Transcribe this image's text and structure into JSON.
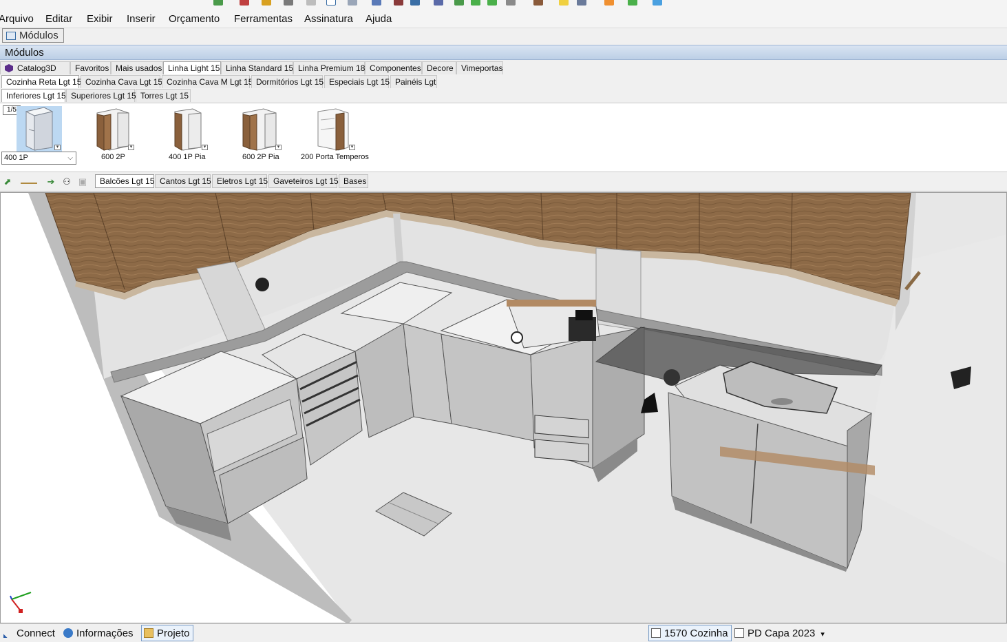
{
  "colors": {
    "accent": "#3a6ea5",
    "panel_header": "#c7d7ec",
    "wood": "#8b6845",
    "cabinet_gray": "#c9c9c9",
    "selected_module": "#bcd8f2"
  },
  "menu": {
    "items": [
      "Arquivo",
      "Editar",
      "Exibir",
      "Inserir",
      "Orçamento",
      "Ferramentas",
      "Assinatura",
      "Ajuda"
    ]
  },
  "doc_tab": {
    "label": "Módulos",
    "icon": "window-icon"
  },
  "panel": {
    "title": "Módulos"
  },
  "library_tabs": [
    {
      "label": "Catalog3D",
      "icon": "catalog-cube-icon"
    },
    {
      "label": "Favoritos"
    },
    {
      "label": "Mais usados"
    },
    {
      "label": "Linha Light 15",
      "active": true
    },
    {
      "label": "Linha Standard 15"
    },
    {
      "label": "Linha Premium 18"
    },
    {
      "label": "Componentes"
    },
    {
      "label": "Decore"
    },
    {
      "label": "Vimeportas"
    }
  ],
  "group_tabs": [
    {
      "label": "Cozinha Reta Lgt 15",
      "active": true
    },
    {
      "label": "Cozinha Cava Lgt 15"
    },
    {
      "label": "Cozinha Cava M Lgt 15"
    },
    {
      "label": "Dormitórios Lgt 15"
    },
    {
      "label": "Especiais Lgt 15"
    },
    {
      "label": "Painéis Lgt"
    }
  ],
  "type_tabs": [
    {
      "label": "Inferiores Lgt 15",
      "active": true
    },
    {
      "label": "Superiores Lgt 15"
    },
    {
      "label": "Torres Lgt 15"
    }
  ],
  "gallery": {
    "page": "1/5",
    "selected_value": "400 1P",
    "modules": [
      {
        "label": "400 1P",
        "selected": true
      },
      {
        "label": "600 2P"
      },
      {
        "label": "400 1P Pia"
      },
      {
        "label": "600 2P Pia"
      },
      {
        "label": "200 Porta Temperos"
      }
    ]
  },
  "subbar": {
    "icons": [
      "insert-module-icon",
      "line-style-icon",
      "export-icon",
      "binoculars-icon",
      "lock-icon"
    ],
    "tabs": [
      {
        "label": "Balcões Lgt 15",
        "active": true
      },
      {
        "label": "Cantos Lgt 15"
      },
      {
        "label": "Eletros Lgt 15"
      },
      {
        "label": "Gaveteiros Lgt 15"
      },
      {
        "label": "Bases"
      }
    ]
  },
  "status": {
    "connect": "Connect",
    "info": "Informações",
    "project": "Projeto",
    "environment": "1570 Cozinha",
    "doc": "PD Capa 2023"
  }
}
